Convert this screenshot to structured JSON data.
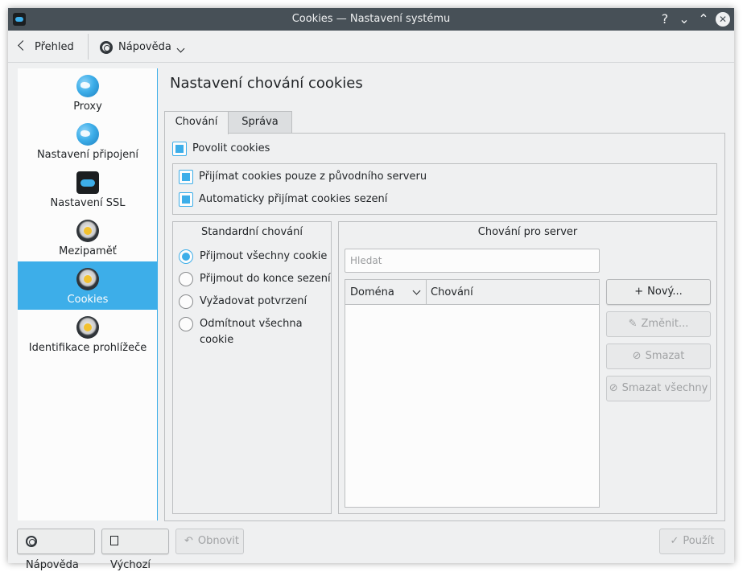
{
  "window": {
    "title": "Cookies  — Nastavení systému",
    "buttons": {
      "help": "?",
      "minimize": "⌄",
      "maximize": "⌃",
      "close": "✕"
    }
  },
  "toolbar": {
    "back_label": "Přehled",
    "help_label": "Nápověda"
  },
  "sidebar": {
    "items": [
      {
        "label": "Proxy",
        "icon": "globe-icon"
      },
      {
        "label": "Nastavení připojení",
        "icon": "globe-icon"
      },
      {
        "label": "Nastavení SSL",
        "icon": "ssl-toggle-icon"
      },
      {
        "label": "Mezipaměť",
        "icon": "cache-icon"
      },
      {
        "label": "Cookies",
        "icon": "cookie-icon",
        "active": true
      },
      {
        "label": "Identifikace prohlížeče",
        "icon": "browser-id-icon"
      }
    ]
  },
  "main": {
    "title": "Nastavení chování cookies",
    "tabs": [
      {
        "label": "Chování",
        "active": true
      },
      {
        "label": "Správa",
        "active": false
      }
    ],
    "enable_cookies": {
      "label": "Povolit cookies",
      "checked": true
    },
    "sub_options": [
      {
        "label": "Přijímat cookies pouze z původního serveru",
        "checked": true
      },
      {
        "label": "Automaticky přijímat cookies sezení",
        "checked": true
      }
    ],
    "default_policy": {
      "title": "Standardní chování",
      "options": [
        {
          "label": "Přijmout všechny cookie",
          "selected": true
        },
        {
          "label": "Přijmout do konce sezení",
          "selected": false
        },
        {
          "label": "Vyžadovat potvrzení",
          "selected": false
        },
        {
          "label": "Odmítnout všechna cookie",
          "selected": false
        }
      ]
    },
    "server_policy": {
      "title": "Chování pro server",
      "search_placeholder": "Hledat",
      "columns": [
        "Doména",
        "Chování"
      ],
      "rows": [],
      "buttons": {
        "new": "Nový...",
        "change": "Změnit...",
        "delete": "Smazat",
        "delete_all": "Smazat všechny"
      }
    }
  },
  "footer": {
    "help": "Nápověda",
    "defaults": "Výchozí",
    "reset": "Obnovit",
    "apply": "Použít"
  },
  "colors": {
    "accent": "#3daee9",
    "titlebar": "#475057",
    "window": "#eff0f1"
  }
}
